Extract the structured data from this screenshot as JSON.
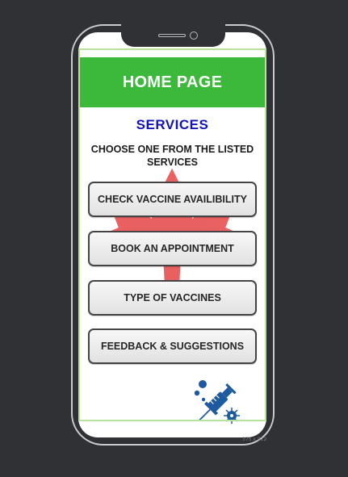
{
  "header": {
    "title": "HOME PAGE"
  },
  "services": {
    "title": "SERVICES",
    "subtitle": "CHOOSE ONE  FROM THE LISTED\nSERVICES"
  },
  "buttons": [
    {
      "label": "CHECK VACCINE AVAILIBILITY"
    },
    {
      "label": "BOOK AN APPOINTMENT"
    },
    {
      "label": "TYPE OF VACCINES"
    },
    {
      "label": "FEEDBACK & SUGGESTIONS"
    }
  ],
  "frame": {
    "size_label": "375 x 812"
  },
  "icons": {
    "background": "maple-leaf-icon",
    "corner": "vaccine-syringe-icon"
  },
  "colors": {
    "header_bg": "#3cb93a",
    "title_text": "#1313b8",
    "leaf": "#e54545",
    "syringe": "#1e5aa0"
  }
}
